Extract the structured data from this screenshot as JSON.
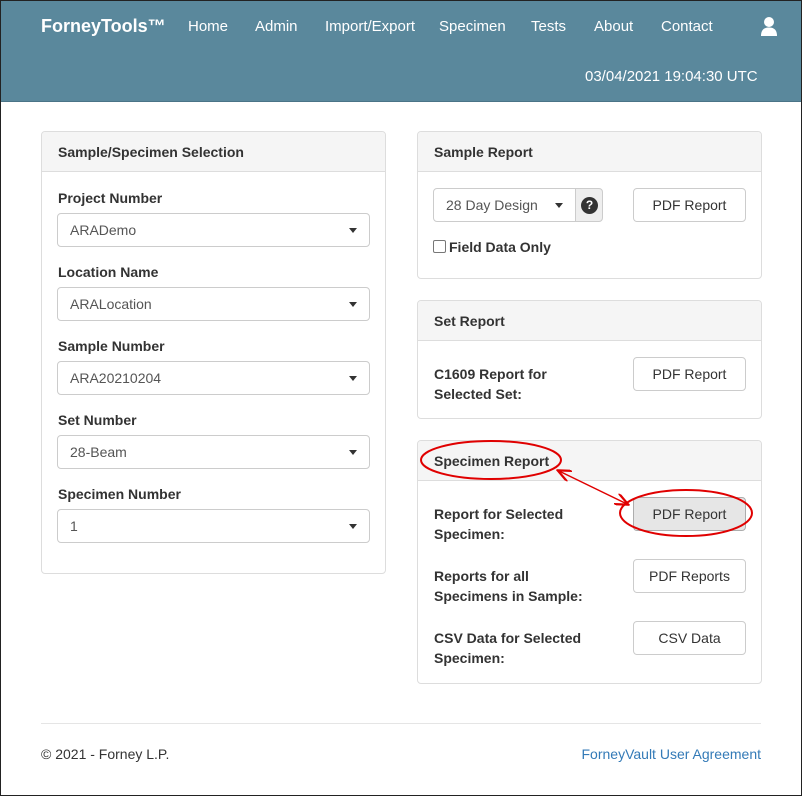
{
  "navbar": {
    "brand": "ForneyTools™",
    "items": [
      "Home",
      "Admin",
      "Import/Export",
      "Specimen",
      "Tests",
      "About",
      "Contact"
    ],
    "timestamp": "03/04/2021 19:04:30 UTC"
  },
  "selection": {
    "title": "Sample/Specimen Selection",
    "fields": [
      {
        "label": "Project Number",
        "value": "ARADemo"
      },
      {
        "label": "Location Name",
        "value": "ARALocation"
      },
      {
        "label": "Sample Number",
        "value": "ARA20210204"
      },
      {
        "label": "Set Number",
        "value": "28-Beam"
      },
      {
        "label": "Specimen Number",
        "value": "1"
      }
    ]
  },
  "sample_report": {
    "title": "Sample Report",
    "design_value": "28 Day Design",
    "help_glyph": "?",
    "pdf_label": "PDF Report",
    "field_data_label": "Field Data Only"
  },
  "set_report": {
    "title": "Set Report",
    "row_label": "C1609 Report for Selected Set:",
    "pdf_label": "PDF Report"
  },
  "specimen_report": {
    "title": "Specimen Report",
    "rows": [
      {
        "label": "Report for Selected Specimen:",
        "button": "PDF Report"
      },
      {
        "label": "Reports for all Specimens in Sample:",
        "button": "PDF Reports"
      },
      {
        "label": "CSV Data for Selected Specimen:",
        "button": "CSV Data"
      }
    ]
  },
  "footer": {
    "copyright": "© 2021 - Forney L.P.",
    "agreement": "ForneyVault User Agreement"
  },
  "colors": {
    "navbar": "#5a889c",
    "annotation": "#e00000",
    "link": "#337ab7"
  },
  "icons": [
    "user-icon",
    "help-icon",
    "caret-down-icon"
  ]
}
